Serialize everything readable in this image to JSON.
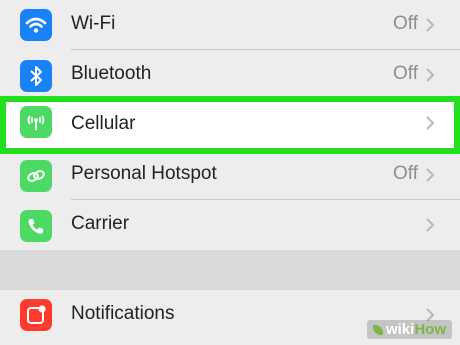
{
  "settings": {
    "rows": [
      {
        "label": "Wi-Fi",
        "value": "Off",
        "icon": "wifi-icon",
        "color": "#1a82f7"
      },
      {
        "label": "Bluetooth",
        "value": "Off",
        "icon": "bluetooth-icon",
        "color": "#1a82f7"
      },
      {
        "label": "Cellular",
        "value": "",
        "icon": "cellular-antenna-icon",
        "color": "#4cd964",
        "highlighted": true
      },
      {
        "label": "Personal Hotspot",
        "value": "Off",
        "icon": "hotspot-link-icon",
        "color": "#4cd964"
      },
      {
        "label": "Carrier",
        "value": "",
        "icon": "phone-icon",
        "color": "#4cd964"
      }
    ],
    "rows2": [
      {
        "label": "Notifications",
        "value": "",
        "icon": "notifications-icon",
        "color": "#ff3b30"
      }
    ],
    "highlight_color": "#22e01e"
  },
  "watermark": {
    "wiki": "wiki",
    "how": "How"
  }
}
